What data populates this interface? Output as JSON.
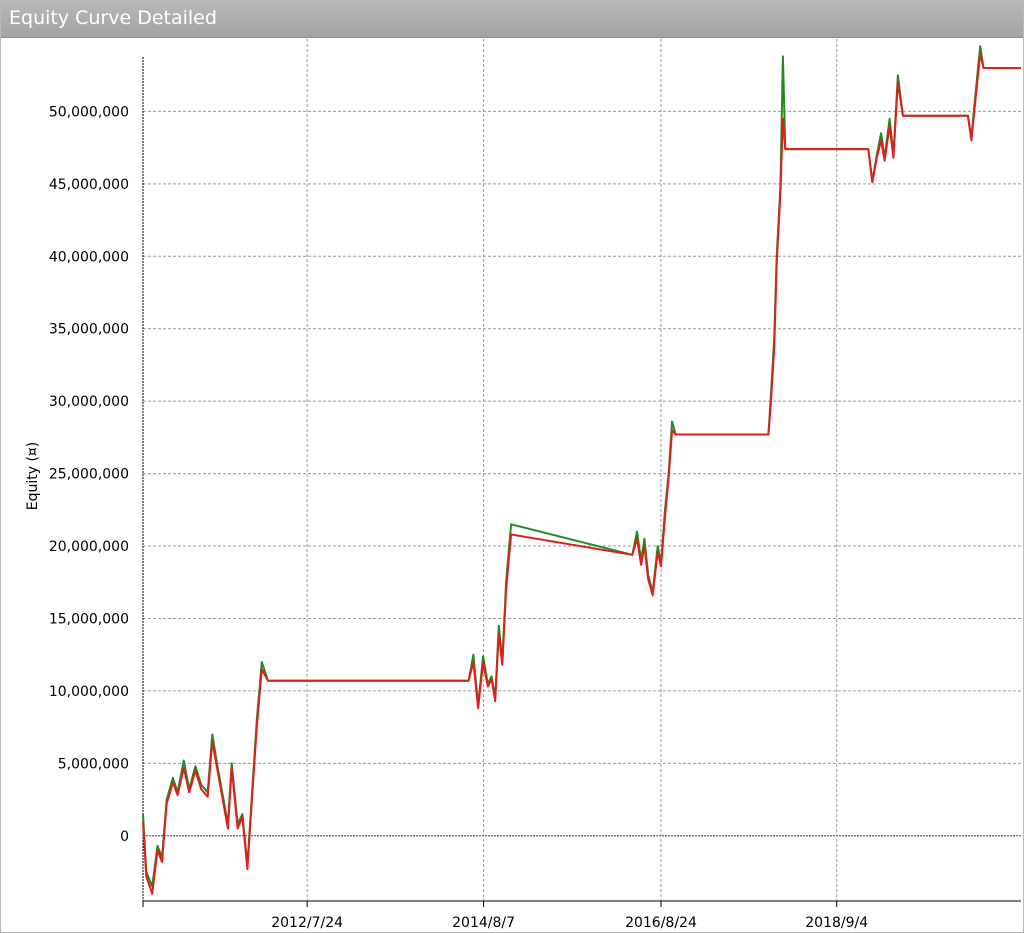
{
  "window": {
    "title": "Equity Curve Detailed"
  },
  "chart_data": {
    "type": "line",
    "title": "",
    "ylabel": "Equity (¤)",
    "xlabel": "",
    "ylim": [
      -4500000,
      55000000
    ],
    "xlim": [
      "2010-09-01",
      "2020-10-20"
    ],
    "grid": true,
    "y_ticks": [
      0,
      5000000,
      10000000,
      15000000,
      20000000,
      25000000,
      30000000,
      35000000,
      40000000,
      45000000,
      50000000
    ],
    "y_tick_labels": [
      "0",
      "5,000,000",
      "10,000,000",
      "15,000,000",
      "20,000,000",
      "25,000,000",
      "30,000,000",
      "35,000,000",
      "40,000,000",
      "45,000,000",
      "50,000,000"
    ],
    "x_ticks": [
      "2012-07-24",
      "2014-08-07",
      "2016-08-24",
      "2018-09-04"
    ],
    "x_tick_labels": [
      "2012/7/24",
      "2014/8/7",
      "2016/8/24",
      "2018/9/4"
    ],
    "series": [
      {
        "color": "#1e8c1e",
        "x": [
          "2010-09-01",
          "2010-09-15",
          "2010-10-10",
          "2010-11-01",
          "2010-11-20",
          "2010-12-10",
          "2011-01-05",
          "2011-01-25",
          "2011-02-20",
          "2011-03-15",
          "2011-04-10",
          "2011-05-05",
          "2011-06-01",
          "2011-06-20",
          "2011-07-10",
          "2011-08-01",
          "2011-08-25",
          "2011-09-10",
          "2011-10-05",
          "2011-10-25",
          "2011-11-15",
          "2011-12-05",
          "2011-12-25",
          "2012-01-15",
          "2012-02-10",
          "2012-03-01",
          "2012-03-25",
          "2012-04-15",
          "2012-05-10",
          "2012-06-01",
          "2012-07-01",
          "2014-06-05",
          "2014-06-25",
          "2014-07-15",
          "2014-08-05",
          "2014-08-25",
          "2014-09-10",
          "2014-09-25",
          "2014-10-10",
          "2014-10-25",
          "2014-11-10",
          "2014-12-01",
          "2016-04-25",
          "2016-05-15",
          "2016-06-01",
          "2016-06-15",
          "2016-07-01",
          "2016-07-20",
          "2016-08-10",
          "2016-08-24",
          "2016-09-10",
          "2016-09-25",
          "2016-10-10",
          "2016-10-25",
          "2016-11-10",
          "2016-11-25",
          "2016-12-10",
          "2017-11-20",
          "2017-12-01",
          "2017-12-15",
          "2017-12-25",
          "2018-01-10",
          "2018-01-20",
          "2018-01-30",
          "2018-02-05",
          "2018-02-10",
          "2019-01-15",
          "2019-02-01",
          "2019-02-20",
          "2019-03-10",
          "2019-03-25",
          "2019-04-15",
          "2019-05-01",
          "2019-05-20",
          "2019-06-10",
          "2019-06-25",
          "2019-07-15",
          "2019-08-01",
          "2019-08-15",
          "2020-03-10",
          "2020-03-25",
          "2020-04-10",
          "2020-05-01",
          "2020-05-15",
          "2020-06-01",
          "2020-10-20"
        ],
        "values": [
          1500000,
          -2500000,
          -3500000,
          -700000,
          -1500000,
          2500000,
          4000000,
          3000000,
          5200000,
          3200000,
          4800000,
          3500000,
          3000000,
          7000000,
          5000000,
          3000000,
          800000,
          5000000,
          800000,
          1500000,
          -2000000,
          3000000,
          8000000,
          12000000,
          10700000,
          10700000,
          10700000,
          10700000,
          10700000,
          10700000,
          10700000,
          10700000,
          12500000,
          9000000,
          12400000,
          10500000,
          11000000,
          9500000,
          14500000,
          12000000,
          17500000,
          21500000,
          19400000,
          21000000,
          19000000,
          20500000,
          18000000,
          16800000,
          20000000,
          18800000,
          22500000,
          25000000,
          28600000,
          27700000,
          27700000,
          27700000,
          27700000,
          27700000,
          30500000,
          34500000,
          40000000,
          45000000,
          53800000,
          47400000,
          47400000,
          47400000,
          47400000,
          45200000,
          47000000,
          48500000,
          46800000,
          49500000,
          47000000,
          52500000,
          49700000,
          49700000,
          49700000,
          49700000,
          49700000,
          49700000,
          48200000,
          51000000,
          54500000,
          53000000,
          53000000,
          53000000
        ]
      },
      {
        "color": "#e01e1e",
        "x": [
          "2010-09-01",
          "2010-09-15",
          "2010-10-10",
          "2010-11-01",
          "2010-11-20",
          "2010-12-10",
          "2011-01-05",
          "2011-01-25",
          "2011-02-20",
          "2011-03-15",
          "2011-04-10",
          "2011-05-05",
          "2011-06-01",
          "2011-06-20",
          "2011-07-10",
          "2011-08-01",
          "2011-08-25",
          "2011-09-10",
          "2011-10-05",
          "2011-10-25",
          "2011-11-15",
          "2011-12-05",
          "2011-12-25",
          "2012-01-15",
          "2012-02-10",
          "2012-03-01",
          "2012-03-25",
          "2012-04-15",
          "2012-05-10",
          "2012-06-01",
          "2012-07-01",
          "2014-06-05",
          "2014-06-25",
          "2014-07-15",
          "2014-08-05",
          "2014-08-25",
          "2014-09-10",
          "2014-09-25",
          "2014-10-10",
          "2014-10-25",
          "2014-11-10",
          "2014-12-01",
          "2016-04-25",
          "2016-05-15",
          "2016-06-01",
          "2016-06-15",
          "2016-07-01",
          "2016-07-20",
          "2016-08-10",
          "2016-08-24",
          "2016-09-10",
          "2016-09-25",
          "2016-10-10",
          "2016-10-25",
          "2016-11-10",
          "2016-11-25",
          "2016-12-10",
          "2017-11-20",
          "2017-12-01",
          "2017-12-15",
          "2017-12-25",
          "2018-01-10",
          "2018-01-20",
          "2018-01-30",
          "2018-02-05",
          "2018-02-10",
          "2019-01-15",
          "2019-02-01",
          "2019-02-20",
          "2019-03-10",
          "2019-03-25",
          "2019-04-15",
          "2019-05-01",
          "2019-05-20",
          "2019-06-10",
          "2019-06-25",
          "2019-07-15",
          "2019-08-01",
          "2019-08-15",
          "2020-03-10",
          "2020-03-25",
          "2020-04-10",
          "2020-05-01",
          "2020-05-15",
          "2020-06-01",
          "2020-10-20"
        ],
        "values": [
          1000000,
          -2800000,
          -4000000,
          -1000000,
          -1800000,
          2200000,
          3700000,
          2800000,
          4700000,
          3000000,
          4500000,
          3200000,
          2700000,
          6500000,
          4700000,
          2700000,
          500000,
          4700000,
          500000,
          1300000,
          -2300000,
          2700000,
          7500000,
          11500000,
          10700000,
          10700000,
          10700000,
          10700000,
          10700000,
          10700000,
          10700000,
          10700000,
          12000000,
          8800000,
          12000000,
          10300000,
          10800000,
          9300000,
          14000000,
          11800000,
          17000000,
          20800000,
          19400000,
          20500000,
          18700000,
          20000000,
          17700000,
          16600000,
          19600000,
          18600000,
          22000000,
          24700000,
          28000000,
          27700000,
          27700000,
          27700000,
          27700000,
          27700000,
          30000000,
          33800000,
          39500000,
          44500000,
          49500000,
          47400000,
          47400000,
          47400000,
          47400000,
          45100000,
          46800000,
          48000000,
          46600000,
          49000000,
          46800000,
          52000000,
          49700000,
          49700000,
          49700000,
          49700000,
          49700000,
          49700000,
          48000000,
          50600000,
          54000000,
          53000000,
          53000000,
          53000000
        ]
      }
    ]
  }
}
